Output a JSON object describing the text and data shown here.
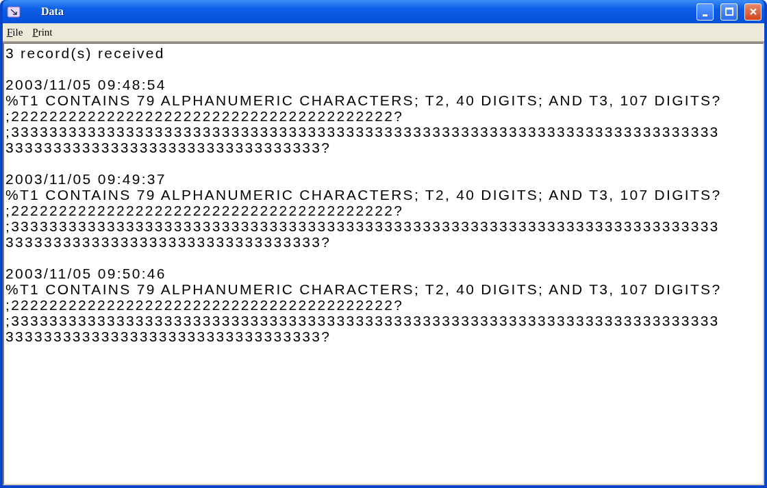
{
  "window": {
    "title": "Data"
  },
  "menu": [
    {
      "label": "File"
    },
    {
      "label": "Print"
    }
  ],
  "content": {
    "header": "3 record(s) received",
    "records": [
      {
        "timestamp": "2003/11/05 09:48:54",
        "lines": [
          "%T1 CONTAINS 79 ALPHANUMERIC CHARACTERS; T2, 40 DIGITS; AND T3, 107 DIGITS?",
          ";2222222222222222222222222222222222222222?",
          ";33333333333333333333333333333333333333333333333333333333333333333333333333",
          "333333333333333333333333333333333?"
        ]
      },
      {
        "timestamp": "2003/11/05 09:49:37",
        "lines": [
          "%T1 CONTAINS 79 ALPHANUMERIC CHARACTERS; T2, 40 DIGITS; AND T3, 107 DIGITS?",
          ";2222222222222222222222222222222222222222?",
          ";33333333333333333333333333333333333333333333333333333333333333333333333333",
          "333333333333333333333333333333333?"
        ]
      },
      {
        "timestamp": "2003/11/05 09:50:46",
        "lines": [
          "%T1 CONTAINS 79 ALPHANUMERIC CHARACTERS; T2, 40 DIGITS; AND T3, 107 DIGITS?",
          ";2222222222222222222222222222222222222222?",
          ";33333333333333333333333333333333333333333333333333333333333333333333333333",
          "333333333333333333333333333333333?"
        ]
      }
    ]
  }
}
